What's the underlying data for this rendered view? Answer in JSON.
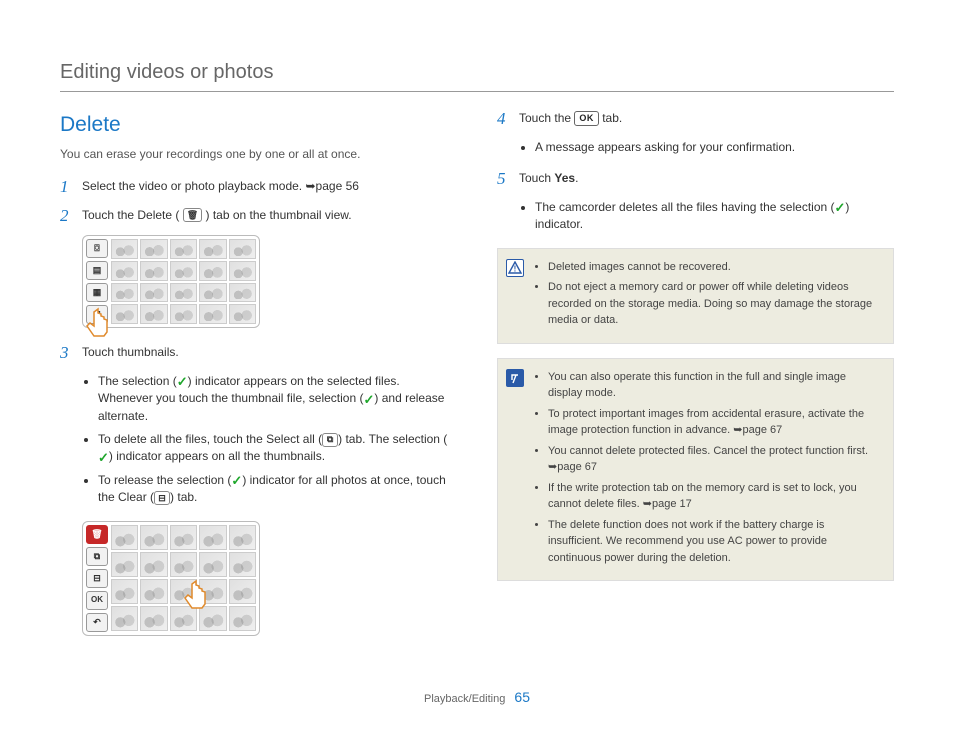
{
  "page": {
    "title": "Editing videos or photos",
    "section_title": "Delete",
    "intro": "You can erase your recordings one by one or all at once.",
    "footer_section": "Playback/Editing",
    "page_number": "65"
  },
  "icons": {
    "arrow": "➥",
    "ok": "OK",
    "check": "✓"
  },
  "steps": {
    "s1": {
      "num": "1",
      "text_a": "Select the video or photo playback mode. ",
      "text_b": "page 56"
    },
    "s2": {
      "num": "2",
      "text_a": "Touch the Delete (",
      "text_b": ") tab on the thumbnail view."
    },
    "s3": {
      "num": "3",
      "text": "Touch thumbnails."
    },
    "s3_bullets": {
      "b1_a": "The selection (",
      "b1_b": ") indicator appears on the selected files. Whenever you touch the thumbnail file, selection (",
      "b1_c": ") and release alternate.",
      "b2_a": "To delete all the files, touch the Select all (",
      "b2_b": ") tab. The selection (",
      "b2_c": ") indicator appears on all the thumbnails.",
      "b3_a": "To release the selection (",
      "b3_b": ") indicator for all photos at once, touch the Clear (",
      "b3_c": ") tab."
    },
    "s4": {
      "num": "4",
      "text_a": "Touch the ",
      "text_b": " tab."
    },
    "s4_bullet": "A message appears asking for your confirmation.",
    "s5": {
      "num": "5",
      "text_a": "Touch ",
      "yes": "Yes",
      "text_b": "."
    },
    "s5_bullet_a": "The camcorder deletes all the files having the selection (",
    "s5_bullet_b": ") indicator."
  },
  "warn_box": {
    "b1": "Deleted images cannot be recovered.",
    "b2": "Do not eject a memory card or power off while deleting videos recorded on the storage media. Doing so may damage the storage media or data."
  },
  "note_box": {
    "b1": "You can also operate this function in the full and single image display mode.",
    "b2_a": "To protect important images from accidental erasure, activate the image protection function in advance. ",
    "b2_b": "page 67",
    "b3_a": "You cannot delete protected files. Cancel the protect function first. ",
    "b3_b": "page 67",
    "b4_a": "If the write protection tab on the memory card is set to lock, you cannot delete files. ",
    "b4_b": "page 17",
    "b5": "The delete function does not work if the battery charge is insufficient. We recommend you use AC power to provide continuous power during the deletion."
  },
  "shot_tabs": {
    "camera": "⌼",
    "video": "▤",
    "film": "▦",
    "thumb": "⊞",
    "back": "↶",
    "trash": "🗑",
    "selectall": "⧉",
    "clear": "⊟",
    "ok": "OK"
  }
}
